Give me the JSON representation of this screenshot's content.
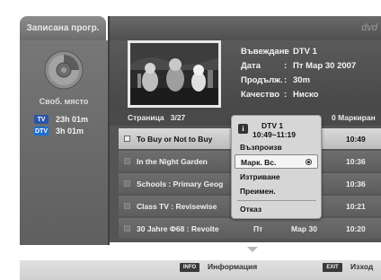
{
  "header": {
    "tab_title": "Записана прогр.",
    "brand": "dvd"
  },
  "storage": {
    "free_space_label": "Своб. място",
    "tv_badge": "TV",
    "tv_time": "23h 01m",
    "dtv_badge": "DTV",
    "dtv_time": "3h 01m"
  },
  "program_info": {
    "recorded_label": "Въвеждане",
    "recorded_value": "DTV 1",
    "date_label": "Дата",
    "date_value": "Пт Мар 30 2007",
    "duration_label": "Продълж.",
    "duration_value": "30m",
    "quality_label": "Качество",
    "quality_value": "Ниско",
    "separator": ":"
  },
  "list": {
    "page_label": "Страница",
    "page_value": "3/27",
    "marked_label": "0 Маркиран",
    "rows": [
      {
        "title": "To Buy or Not to Buy",
        "day": "",
        "date": "",
        "time": "10:49",
        "selected": true
      },
      {
        "title": "In the Night Garden",
        "day": "",
        "date": "",
        "time": "10:36",
        "selected": false
      },
      {
        "title": "Schools : Primary Geog",
        "day": "",
        "date": "",
        "time": "10:36",
        "selected": false
      },
      {
        "title": "Class TV : Revisewise",
        "day": "",
        "date": "",
        "time": "10:21",
        "selected": false
      },
      {
        "title": "30 Jahre Φ68 : Revolte",
        "day": "Пт",
        "date": "Мар 30",
        "time": "10:20",
        "selected": false
      }
    ]
  },
  "popup": {
    "info_glyph": "i",
    "channel": "DTV 1",
    "time_range": "10:49~11:19",
    "items": [
      {
        "label": "Възпроизв"
      },
      {
        "label": "Марк. Вс."
      },
      {
        "label": "Изтриване"
      },
      {
        "label": "Преимен."
      },
      {
        "label": "Отказ"
      }
    ]
  },
  "footer": {
    "info_key": "INFO",
    "info_label": "Информация",
    "exit_key": "EXIT",
    "exit_label": "Изход"
  },
  "colors": {
    "panel_gray": "#6a6a6a",
    "selected_row": "#cfcfcf",
    "tv_badge": "#2a55a8",
    "dtv_badge": "#1e6fd0"
  }
}
